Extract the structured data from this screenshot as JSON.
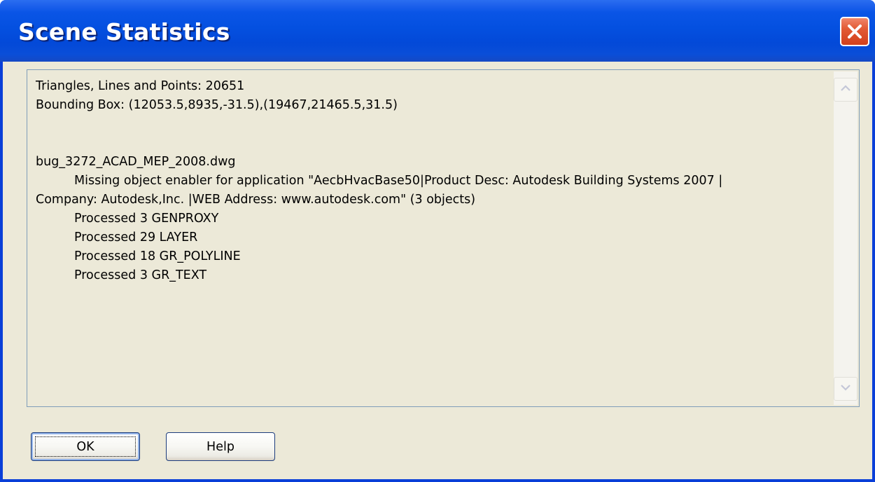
{
  "window": {
    "title": "Scene Statistics",
    "close_icon": "close-icon"
  },
  "report": {
    "lines": {
      "triangles": "Triangles, Lines and Points: 20651",
      "bounding_box": "Bounding Box: (12053.5,8935,-31.5),(19467,21465.5,31.5)",
      "filename": "bug_3272_ACAD_MEP_2008.dwg",
      "missing_enabler_1": "Missing object enabler for application \"AecbHvacBase50|Product Desc: Autodesk Building Systems 2007 |",
      "missing_enabler_2": "Company: Autodesk,Inc. |WEB Address: www.autodesk.com\" (3 objects)",
      "processed_genproxy": "Processed 3 GENPROXY",
      "processed_layer": "Processed 29 LAYER",
      "processed_polyline": "Processed 18 GR_POLYLINE",
      "processed_text": "Processed 3 GR_TEXT"
    }
  },
  "scrollbar": {
    "up_icon": "chevron-up-icon",
    "down_icon": "chevron-down-icon"
  },
  "buttons": {
    "ok_label": "OK",
    "help_label": "Help"
  },
  "colors": {
    "titlebar": "#0450e0",
    "close": "#e25a34",
    "dialog_bg": "#ece9d8"
  }
}
